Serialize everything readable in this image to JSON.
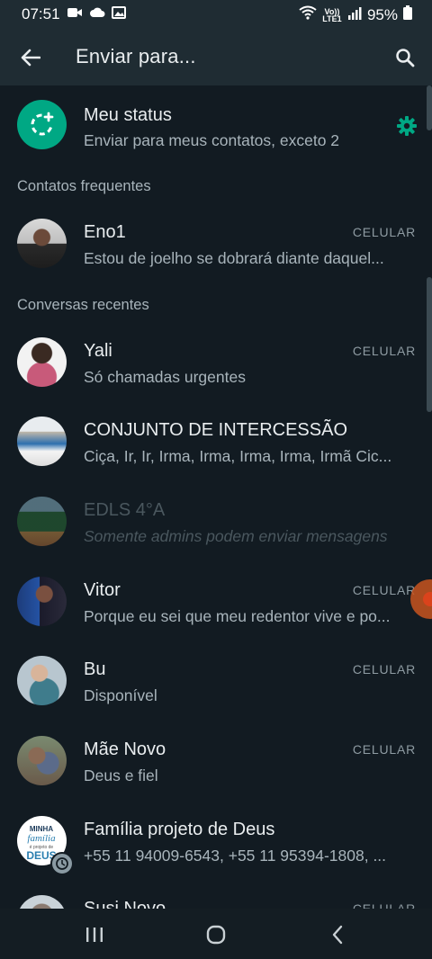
{
  "status_bar": {
    "time": "07:51",
    "battery": "95%",
    "network": "Vo)) LTE1"
  },
  "app_bar": {
    "title": "Enviar para..."
  },
  "my_status": {
    "title": "Meu status",
    "subtitle": "Enviar para meus contatos, exceto 2"
  },
  "sections": {
    "frequent": "Contatos frequentes",
    "recent": "Conversas recentes"
  },
  "frequent_contacts": [
    {
      "name": "Eno1",
      "subtitle": "Estou de joelho se dobrará diante daquel...",
      "tag": "CELULAR"
    }
  ],
  "recent_chats": [
    {
      "name": "Yali",
      "subtitle": "Só chamadas urgentes",
      "tag": "CELULAR"
    },
    {
      "name": "CONJUNTO  DE  INTERCESSÃO",
      "subtitle": "Ciça, Ir, Ir, Irma, Irma, Irma, Irma, Irmã Cic...",
      "tag": ""
    },
    {
      "name": "EDLS 4°A",
      "subtitle": "Somente admins podem enviar mensagens",
      "tag": ""
    },
    {
      "name": "Vitor",
      "subtitle": "Porque eu sei que meu redentor vive e po...",
      "tag": "CELULAR"
    },
    {
      "name": "Bu",
      "subtitle": "Disponível",
      "tag": "CELULAR"
    },
    {
      "name": "Mãe Novo",
      "subtitle": "Deus e fiel",
      "tag": "CELULAR"
    },
    {
      "name": "Família projeto de Deus",
      "subtitle": "+55 11 94009-6543, +55 11 95394-1808, ...",
      "tag": ""
    },
    {
      "name": "Susi Novo",
      "subtitle": "",
      "tag": "CELULAR"
    }
  ],
  "avatar_text": {
    "familia": "MINHA família é projeto de DEUS"
  },
  "colors": {
    "accent": "#00a884",
    "background": "#121b22",
    "app_bar": "#1f2c33"
  }
}
